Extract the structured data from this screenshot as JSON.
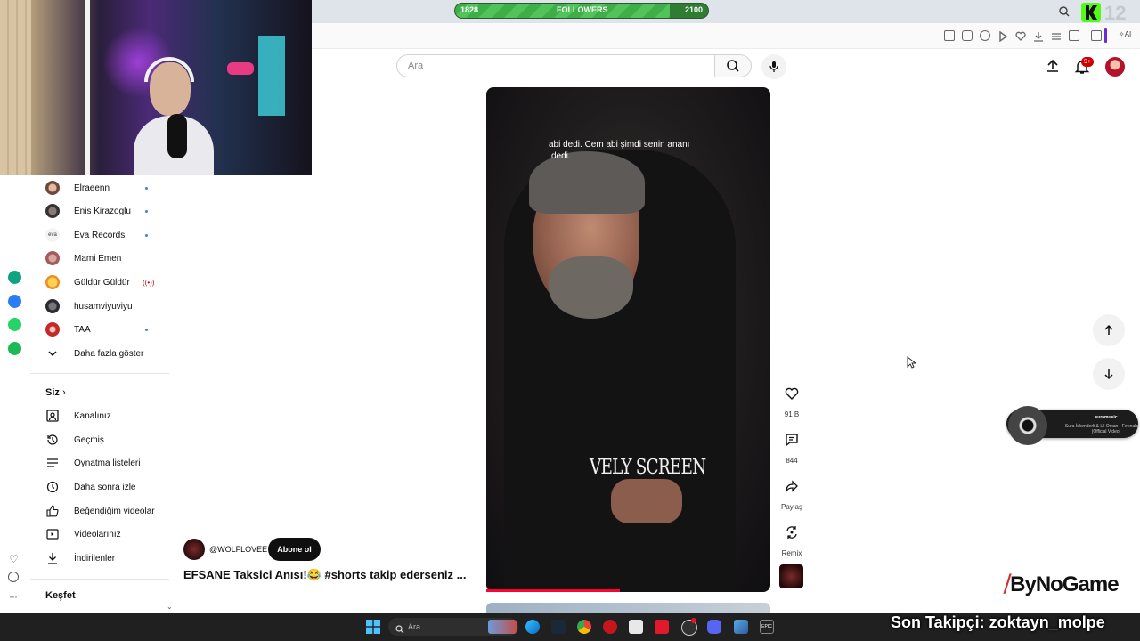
{
  "stream": {
    "followers_label": "FOLLOWERS",
    "followers_current": "1828",
    "followers_goal": "2100",
    "followers_progress": 0.85,
    "corner_number": "12"
  },
  "search": {
    "placeholder": "Ara"
  },
  "header": {
    "notification_badge": "9+"
  },
  "sidebar": {
    "subscriptions": [
      {
        "label": "Elraeenn",
        "status": "new"
      },
      {
        "label": "Enis Kirazoglu",
        "status": "new"
      },
      {
        "label": "Eva Records",
        "status": "new"
      },
      {
        "label": "Mami Emen",
        "status": ""
      },
      {
        "label": "Güldür Güldür",
        "status": "live"
      },
      {
        "label": "husamviyuviyu",
        "status": ""
      },
      {
        "label": "TAA",
        "status": "new"
      }
    ],
    "show_more": "Daha fazla göster",
    "you_section": "Siz",
    "you_items": [
      {
        "label": "Kanalınız",
        "icon": "channel-icon"
      },
      {
        "label": "Geçmiş",
        "icon": "history-icon"
      },
      {
        "label": "Oynatma listeleri",
        "icon": "playlist-icon"
      },
      {
        "label": "Daha sonra izle",
        "icon": "clock-icon"
      },
      {
        "label": "Beğendiğim videolar",
        "icon": "thumbs-up-icon"
      },
      {
        "label": "Videolarınız",
        "icon": "video-icon"
      },
      {
        "label": "İndirilenler",
        "icon": "download-icon"
      }
    ],
    "explore_section": "Keşfet"
  },
  "video": {
    "caption_line1": "abi dedi. Cem abi şimdi senin ananı",
    "caption_line2": "dedi.",
    "overlay_brand": "VELY SCREEN",
    "progress": 0.47,
    "channel": "@WOLFLOVEE",
    "subscribe_label": "Abone ol",
    "title": "EFSANE Taksici Anısı!😂 #shorts takip  ederseniz ..."
  },
  "actions": {
    "likes": "91 B",
    "comments": "844",
    "share": "Paylaş",
    "remix": "Remix"
  },
  "music": {
    "user": "suramusic",
    "track": "Sura İskenderli & Lil Orxan - Fırtınalardan (Official Video)"
  },
  "logo": "ByNoGame",
  "taskbar": {
    "search_placeholder": "Ara",
    "ticker": "Son Takipçi: zoktayn_molpe"
  },
  "colors": {
    "follow_bar": "#3fae48",
    "subscribe_bg": "#0f0f0f",
    "progress_red": "#ff0033",
    "notification_badge": "#cc0000"
  }
}
